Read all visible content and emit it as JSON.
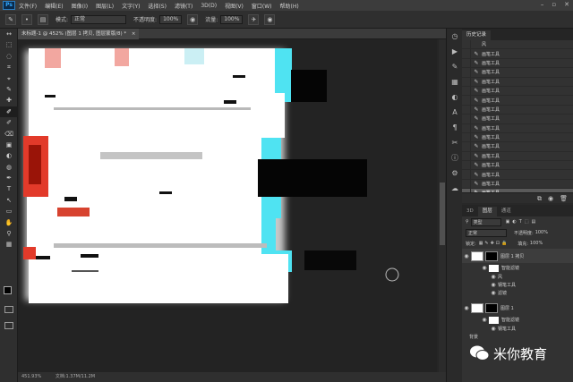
{
  "app": {
    "logo": "Ps"
  },
  "menu": [
    "文件(F)",
    "编辑(E)",
    "图像(I)",
    "图层(L)",
    "文字(Y)",
    "选择(S)",
    "滤镜(T)",
    "3D(D)",
    "视图(V)",
    "窗口(W)",
    "帮助(H)"
  ],
  "window_controls": [
    "–",
    "▫",
    "✕"
  ],
  "options": {
    "mode_label": "模式:",
    "mode_value": "正常",
    "opacity_label": "不透明度:",
    "opacity_value": "100%",
    "flow_label": "流量:",
    "flow_value": "100%"
  },
  "document": {
    "tab_title": "未标题-1 @ 452% (图层 1 拷贝, 图层蒙版/8) *",
    "tab_close": "×"
  },
  "status": {
    "zoom": "451.93%",
    "doc": "文档:1.37M/11.2M"
  },
  "tools": [
    "↔",
    "⬚",
    "◌",
    "⌗",
    "⌖",
    "✎",
    "✚",
    "✐",
    "✐",
    "⌫",
    "▣",
    "◐",
    "◍",
    "✒",
    "T",
    "↖",
    "▭",
    "✋",
    "⚲",
    "▦",
    "⬛"
  ],
  "history": {
    "tab_active": "历史记录",
    "snapshot_label": "风",
    "items": [
      "画笔工具",
      "画笔工具",
      "画笔工具",
      "画笔工具",
      "画笔工具",
      "画笔工具",
      "画笔工具",
      "画笔工具",
      "画笔工具",
      "画笔工具",
      "画笔工具",
      "画笔工具",
      "画笔工具",
      "画笔工具",
      "画笔工具",
      "画笔工具"
    ]
  },
  "layers": {
    "tabs": [
      "3D",
      "图层",
      "通道"
    ],
    "filter_kind": "类型",
    "blend_mode": "正常",
    "opacity_label": "不透明度:",
    "opacity_value": "100%",
    "lock_label": "锁定:",
    "fill_label": "填充:",
    "fill_value": "100%",
    "layer1_name": "图层 1 拷贝",
    "layer1_smart": "智能滤镜",
    "layer1_filters": [
      "风",
      "钢笔工具",
      "滤镜"
    ],
    "layer2_name": "图层 1",
    "layer2_smart": "智能滤镜",
    "layer2_filters": [
      "钢笔工具"
    ],
    "layer3_name": "背景"
  },
  "watermark": {
    "text": "米你教育"
  }
}
